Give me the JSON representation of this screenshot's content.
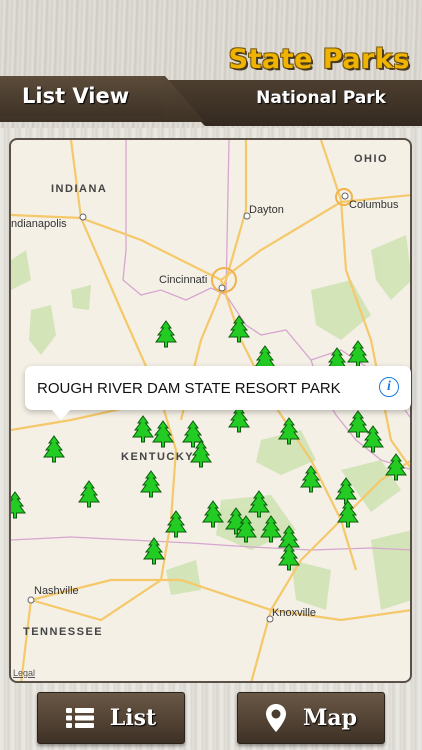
{
  "header": {
    "app_title": "State Parks",
    "list_view_label": "List View",
    "subtitle": "National Park"
  },
  "map": {
    "state_labels": [
      "OHIO",
      "INDIANA",
      "KENTUCKY",
      "TENNESSEE"
    ],
    "city_labels": [
      "Dayton",
      "Columbus",
      "ndianapolis",
      "Cincinnati",
      "Nashville",
      "Knoxville"
    ],
    "legal_label": "Legal",
    "marker_icon": "park-tree-icon",
    "marker_color": "#22cc22",
    "callout": {
      "title": "ROUGH RIVER DAM STATE RESORT PARK",
      "info_icon": "info-icon"
    }
  },
  "bottom_bar": {
    "list_label": "List",
    "list_icon": "list-icon",
    "map_label": "Map",
    "map_icon": "map-pin-icon"
  },
  "colors": {
    "title_gold": "#f0b400",
    "wood_brown": "#4a3c2e",
    "info_blue": "#1a7ae0"
  }
}
